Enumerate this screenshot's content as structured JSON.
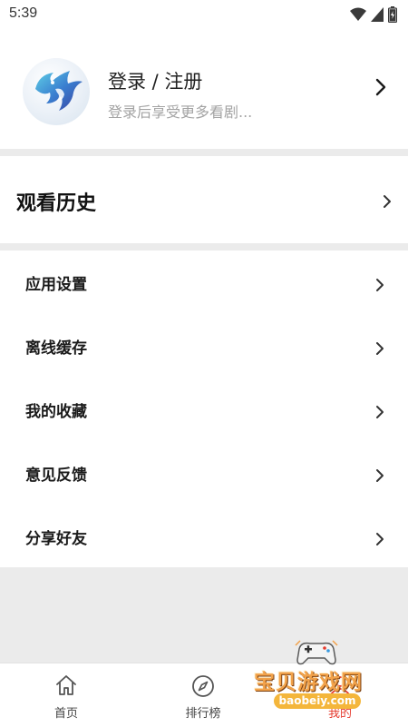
{
  "status_bar": {
    "time": "5:39",
    "icons": [
      "wifi-icon",
      "cellular-icon",
      "battery-icon"
    ]
  },
  "profile": {
    "title": "登录 / 注册",
    "subtitle": "登录后享受更多看剧...",
    "avatar_icon": "dragon-logo-icon"
  },
  "history": {
    "label": "观看历史"
  },
  "menu": {
    "items": [
      {
        "label": "应用设置"
      },
      {
        "label": "离线缓存"
      },
      {
        "label": "我的收藏"
      },
      {
        "label": "意见反馈"
      },
      {
        "label": "分享好友"
      }
    ]
  },
  "bottom_nav": {
    "items": [
      {
        "label": "首页",
        "icon": "home-icon"
      },
      {
        "label": "排行榜",
        "icon": "compass-icon"
      },
      {
        "label": "我的",
        "icon": "user-icon",
        "active": true
      }
    ],
    "active_color": "#e53b2f"
  },
  "watermark": {
    "text": "宝贝游戏网",
    "url": "baobeiy.com"
  }
}
